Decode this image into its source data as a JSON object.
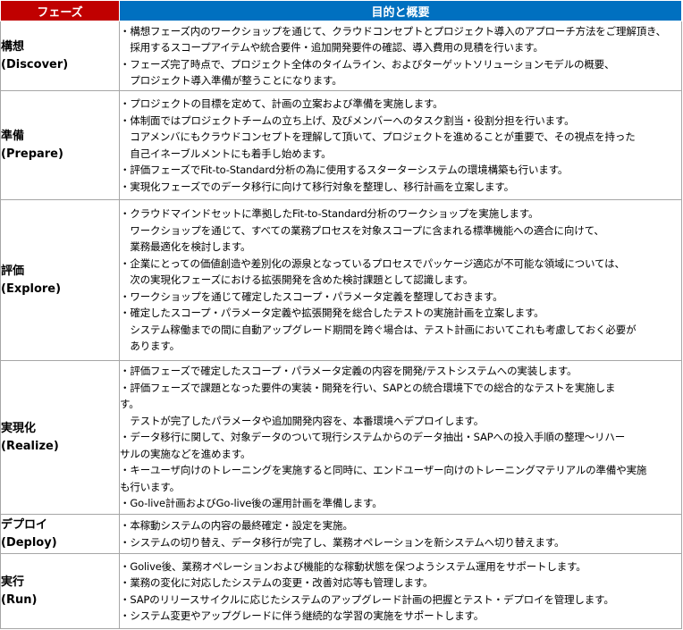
{
  "header": {
    "phase": "フェーズ",
    "purpose": "目的と概要"
  },
  "rows": [
    {
      "phase_ja": "構想",
      "phase_en": "(Discover)",
      "lines": [
        "・構想フェーズ内のワークショップを通じて、クラウドコンセプトとプロジェクト導入のアプローチ方法をご理解頂き、",
        "　採用するスコープアイテムや統合要件・追加開発要件の確認、導入費用の見積を行います。",
        "・フェーズ完了時点で、プロジェクト全体のタイムライン、およびターゲットソリューションモデルの概要、",
        "　プロジェクト導入準備が整うことになります。"
      ]
    },
    {
      "phase_ja": "準備",
      "phase_en": "(Prepare)",
      "lines": [
        "・プロジェクトの目標を定めて、計画の立案および準備を実施します。",
        "・体制面ではプロジェクトチームの立ち上げ、及びメンバーへのタスク割当・役割分担を行います。",
        "　コアメンバにもクラウドコンセプトを理解して頂いて、プロジェクトを進めることが重要で、その視点を持った",
        "　自己イネーブルメントにも着手し始めます。",
        "・評価フェーズでFit-to-Standard分析の為に使用するスターターシステムの環境構築も行います。",
        "・実現化フェーズでのデータ移行に向けて移行対象を整理し、移行計画を立案します。"
      ]
    },
    {
      "phase_ja": "評価",
      "phase_en": "(Explore)",
      "lines": [
        "・クラウドマインドセットに準拠したFit-to-Standard分析のワークショップを実施します。",
        "　ワークショップを通じて、すべての業務プロセスを対象スコープに含まれる標準機能への適合に向けて、",
        "　業務最適化を検討します。",
        "・企業にとっての価値創造や差別化の源泉となっているプロセスでパッケージ適応が不可能な領域については、",
        "　次の実現化フェーズにおける拡張開発を含めた検討課題として認識します。",
        "・ワークショップを通じて確定したスコープ・パラメータ定義を整理しておきます。",
        "・確定したスコープ・パラメータ定義や拡張開発を総合したテストの実施計画を立案します。",
        "　システム稼働までの間に自動アップグレード期間を跨ぐ場合は、テスト計画においてこれも考慮しておく必要が",
        "　あります。"
      ]
    },
    {
      "phase_ja": "実現化",
      "phase_en": "(Realize)",
      "lines": [
        "・評価フェーズで確定したスコープ・パラメータ定義の内容を開発/テストシステムへの実装します。",
        "・評価フェーズで課題となった要件の実装・開発を行い、SAPとの統合環境下での総合的なテストを実施しま",
        "す。",
        "　テストが完了したパラメータや追加開発内容を、本番環境へデプロイします。",
        "・データ移行に関して、対象データのついて現行システムからのデータ抽出・SAPへの投入手順の整理～リハー",
        "サルの実施などを進めます。",
        "・キーユーザ向けのトレーニングを実施すると同時に、エンドユーザー向けのトレーニングマテリアルの準備や実施",
        "も行います。",
        "・Go-live計画およびGo-live後の運用計画を準備します。"
      ]
    },
    {
      "phase_ja": "デプロイ",
      "phase_en": "(Deploy)",
      "lines": [
        "・本稼動システムの内容の最終確定・設定を実施。",
        "・システムの切り替え、データ移行が完了し、業務オペレーションを新システムへ切り替えます。"
      ]
    },
    {
      "phase_ja": "実行",
      "phase_en": "(Run)",
      "lines": [
        "・Golive後、業務オペレーションおよび機能的な稼動状態を保つようシステム運用をサポートします。",
        "・業務の変化に対応したシステムの変更・改善対応等も管理します。",
        "・SAPのリリースサイクルに応じたシステムのアップグレード計画の把握とテスト・デプロイを管理します。",
        "・システム変更やアップグレードに伴う継続的な学習の実施をサポートします。"
      ]
    }
  ]
}
